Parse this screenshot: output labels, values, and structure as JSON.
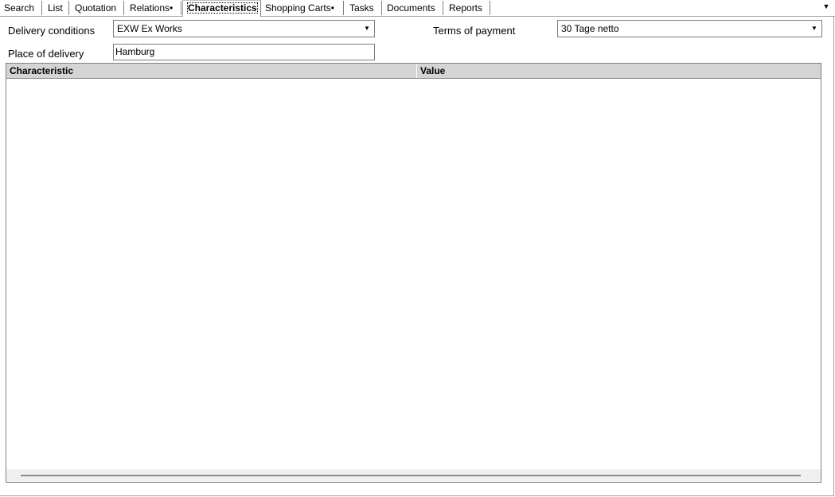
{
  "tabs": [
    {
      "label": "Search"
    },
    {
      "label": "List"
    },
    {
      "label": "Quotation"
    },
    {
      "label": "Relations•"
    },
    {
      "label": "Characteristics"
    },
    {
      "label": "Shopping Carts•"
    },
    {
      "label": "Tasks"
    },
    {
      "label": "Documents"
    },
    {
      "label": "Reports"
    }
  ],
  "active_tab": "Characteristics",
  "form": {
    "delivery_conditions_label": "Delivery conditions",
    "delivery_conditions_value": "EXW Ex Works",
    "terms_of_payment_label": "Terms of payment",
    "terms_of_payment_value": "30 Tage netto",
    "place_of_delivery_label": "Place of delivery",
    "place_of_delivery_value": "Hamburg"
  },
  "grid": {
    "columns": [
      "Characteristic",
      "Value"
    ],
    "rows": []
  },
  "icons": {
    "dropdown": "chevron-down-icon",
    "tab_overflow": "chevron-down-icon"
  }
}
